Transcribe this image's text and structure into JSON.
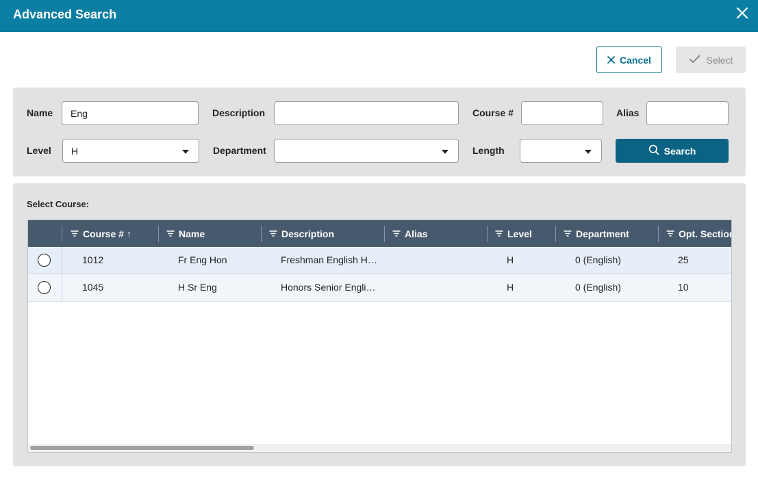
{
  "dialog": {
    "title": "Advanced Search"
  },
  "actions": {
    "cancel_label": "Cancel",
    "select_label": "Select"
  },
  "filters": {
    "name_label": "Name",
    "name_value": "Eng",
    "description_label": "Description",
    "description_value": "",
    "course_label": "Course #",
    "course_value": "",
    "alias_label": "Alias",
    "alias_value": "",
    "level_label": "Level",
    "level_value": "H",
    "department_label": "Department",
    "department_value": "",
    "length_label": "Length",
    "length_value": "",
    "search_label": "Search"
  },
  "results": {
    "title": "Select Course:",
    "columns": [
      "Course #",
      "Name",
      "Description",
      "Alias",
      "Level",
      "Department",
      "Opt. Section"
    ],
    "sort_indicator": "↑",
    "rows": [
      {
        "course": "1012",
        "name": "Fr Eng Hon",
        "description": "Freshman English H…",
        "alias": "",
        "level": "H",
        "department": "0 (English)",
        "opt_section": "25"
      },
      {
        "course": "1045",
        "name": "H Sr Eng",
        "description": "Honors Senior Engli…",
        "alias": "",
        "level": "H",
        "department": "0 (English)",
        "opt_section": "10"
      }
    ]
  },
  "colors": {
    "titlebar": "#0b7fa3",
    "primary_button": "#0b6383",
    "grid_header": "#475a6d",
    "panel": "#e2e2e2"
  },
  "icons": [
    "close-icon",
    "x-icon",
    "checkmark-icon",
    "search-icon",
    "chevron-down-icon",
    "filter-icon",
    "sort-up-icon",
    "radio-icon"
  ]
}
